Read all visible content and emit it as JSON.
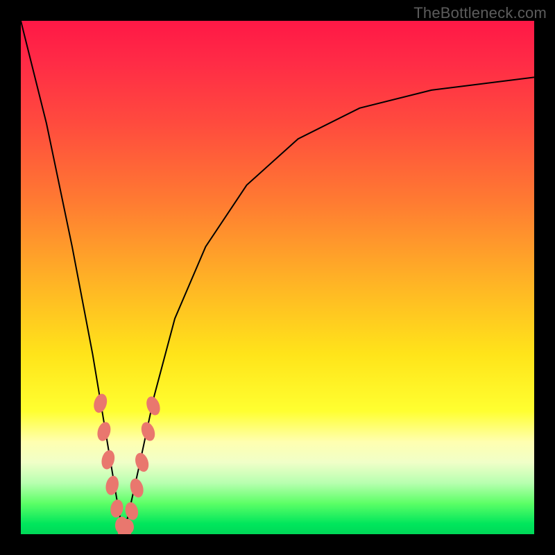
{
  "watermark": "TheBottleneck.com",
  "chart_data": {
    "type": "line",
    "title": "",
    "xlabel": "",
    "ylabel": "",
    "xlim": [
      0,
      100
    ],
    "ylim": [
      0,
      100
    ],
    "background_gradient": {
      "top_color": "#ff1846",
      "bottom_color": "#00d858",
      "meaning": "red = high bottleneck, green = low bottleneck"
    },
    "series": [
      {
        "name": "bottleneck-curve",
        "description": "V-shaped bottleneck percentage curve, minimum near x≈20",
        "x": [
          0,
          5,
          10,
          14,
          17,
          19,
          20,
          21,
          23,
          26,
          30,
          36,
          44,
          54,
          66,
          80,
          100
        ],
        "values": [
          100,
          80,
          56,
          35,
          17,
          5,
          0,
          4,
          13,
          27,
          42,
          56,
          68,
          77,
          83,
          86.5,
          89
        ]
      }
    ],
    "markers": {
      "name": "highlighted-points",
      "description": "Salmon-colored pill markers clustered near the valley on both branches",
      "color": "#e9776e",
      "points": [
        {
          "x": 15.5,
          "y": 25.5
        },
        {
          "x": 16.2,
          "y": 20.0
        },
        {
          "x": 17.0,
          "y": 14.5
        },
        {
          "x": 17.8,
          "y": 9.5
        },
        {
          "x": 18.7,
          "y": 5.0
        },
        {
          "x": 19.6,
          "y": 1.8
        },
        {
          "x": 20.2,
          "y": 0.5
        },
        {
          "x": 20.8,
          "y": 1.5
        },
        {
          "x": 21.6,
          "y": 4.5
        },
        {
          "x": 22.6,
          "y": 9.0
        },
        {
          "x": 23.6,
          "y": 14.0
        },
        {
          "x": 24.8,
          "y": 20.0
        },
        {
          "x": 25.8,
          "y": 25.0
        }
      ]
    }
  }
}
